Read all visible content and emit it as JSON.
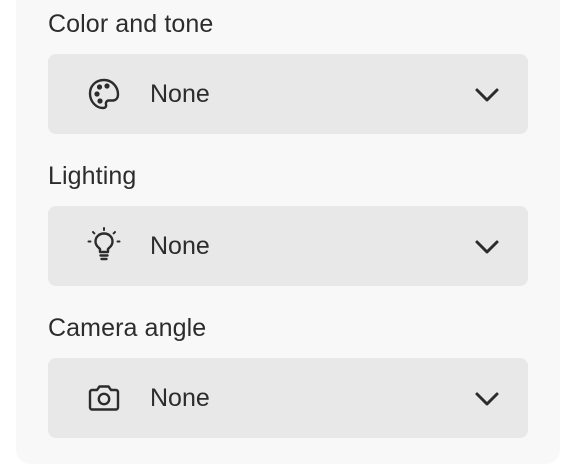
{
  "sections": [
    {
      "label": "Color and tone",
      "value": "None",
      "icon": "palette-icon"
    },
    {
      "label": "Lighting",
      "value": "None",
      "icon": "lightbulb-icon"
    },
    {
      "label": "Camera angle",
      "value": "None",
      "icon": "camera-icon"
    }
  ]
}
